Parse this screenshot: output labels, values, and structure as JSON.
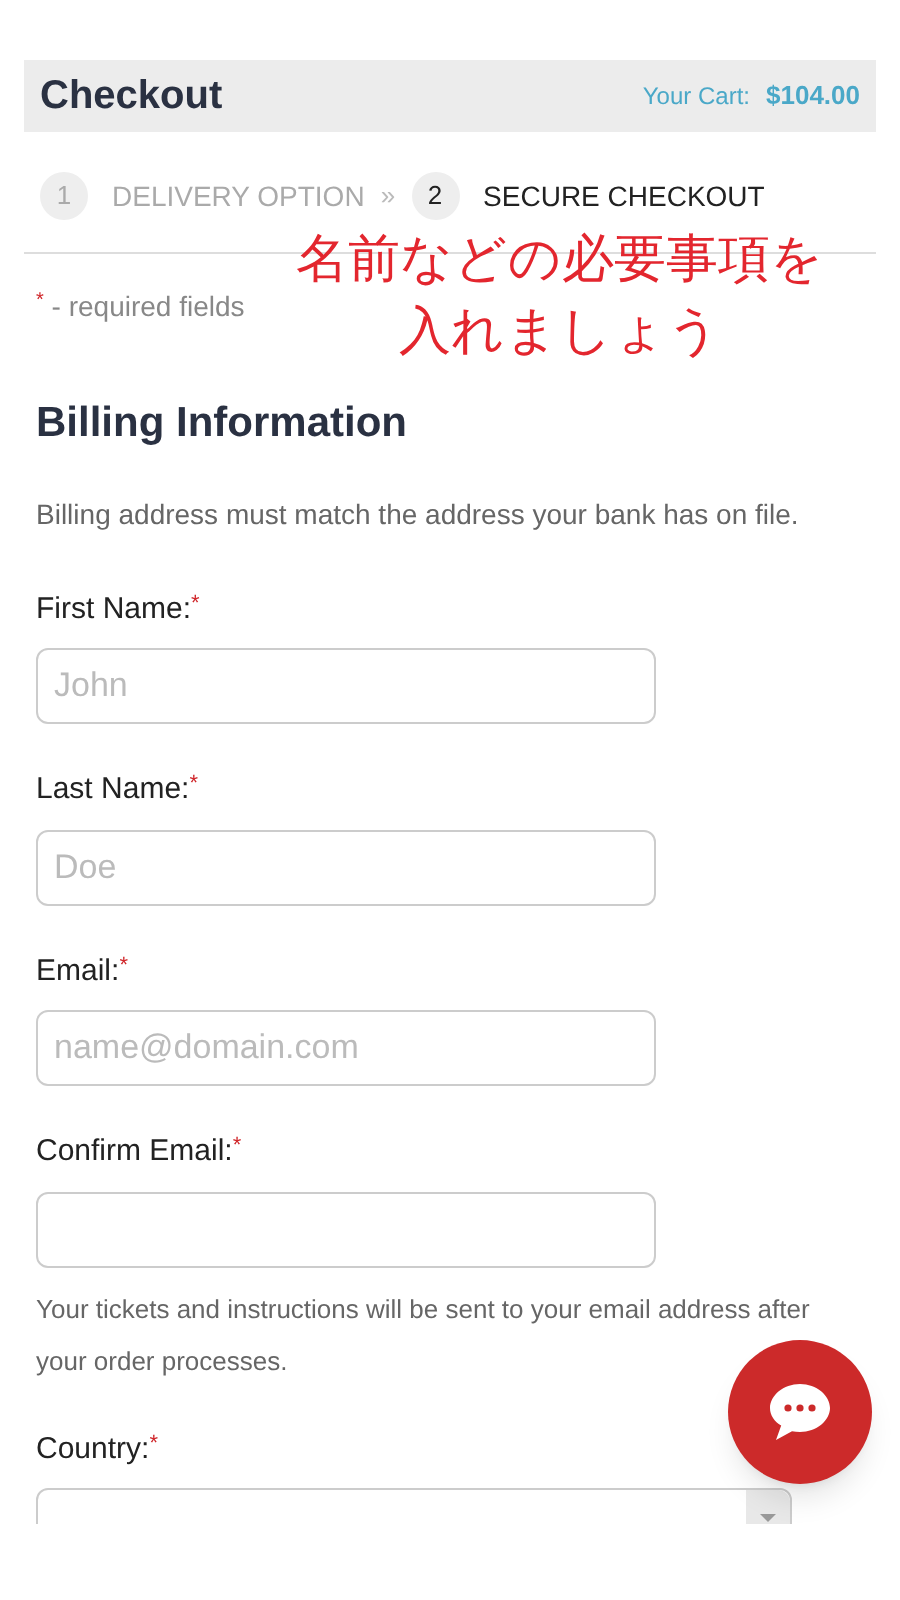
{
  "header": {
    "title": "Checkout",
    "cart_label": "Your Cart:",
    "cart_total": "$104.00"
  },
  "steps": [
    {
      "number": "1",
      "label": "DELIVERY OPTION",
      "selected": false
    },
    {
      "number": "2",
      "label": "SECURE CHECKOUT",
      "selected": true
    }
  ],
  "step_separator": "»",
  "annotation": [
    "名前などの必要事項を",
    "入れましょう"
  ],
  "required_note": {
    "mark": "*",
    "text": " - required fields"
  },
  "section_title": "Billing Information",
  "section_note": "Billing address must match the address your bank has on file.",
  "fields": [
    {
      "kind": "input",
      "label": "First Name:",
      "required": true,
      "placeholder": "John"
    },
    {
      "kind": "input",
      "label": "Last Name:",
      "required": true,
      "placeholder": "Doe"
    },
    {
      "kind": "input",
      "label": "Email:",
      "required": true,
      "placeholder": "name@domain.com"
    },
    {
      "kind": "input",
      "label": "Confirm Email:",
      "required": true,
      "hint": "Your tickets and instructions will be sent to your email address after your order processes."
    },
    {
      "kind": "select",
      "label": "Country:",
      "required": true
    }
  ]
}
